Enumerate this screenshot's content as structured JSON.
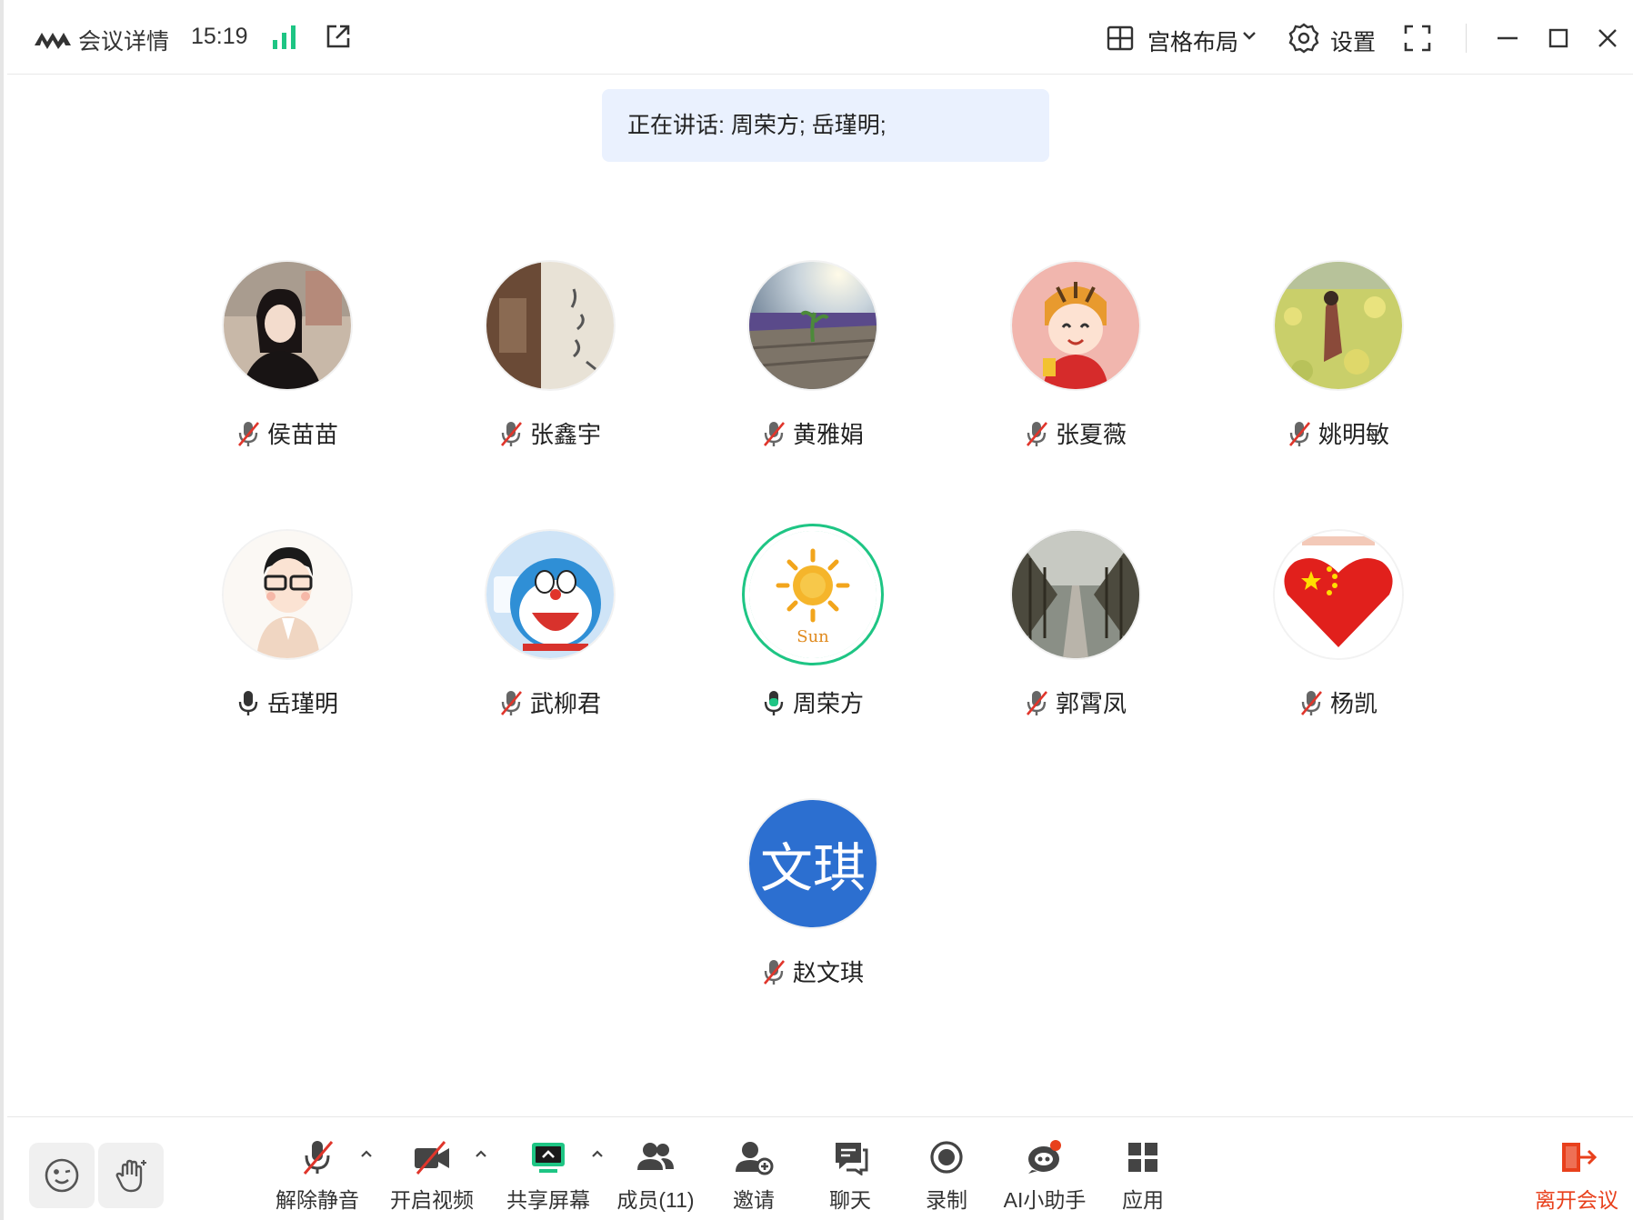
{
  "titlebar": {
    "title": "会议详情",
    "time": "15:19",
    "layout_label": "宫格布局",
    "settings_label": "设置",
    "icons": [
      "app-logo-icon",
      "signal-icon",
      "popout-icon",
      "grid-layout-icon",
      "chevron-down-icon",
      "gear-icon",
      "fullscreen-icon",
      "minimize-icon",
      "maximize-icon",
      "close-icon"
    ]
  },
  "speaking_banner": {
    "text": "正在讲话: 周荣方; 岳瑾明;"
  },
  "participants": [
    {
      "name": "侯苗苗",
      "mic": "muted",
      "avatar": "photo"
    },
    {
      "name": "张鑫宇",
      "mic": "muted",
      "avatar": "photo"
    },
    {
      "name": "黄雅娟",
      "mic": "muted",
      "avatar": "photo"
    },
    {
      "name": "张夏薇",
      "mic": "muted",
      "avatar": "photo"
    },
    {
      "name": "姚明敏",
      "mic": "muted",
      "avatar": "photo"
    },
    {
      "name": "岳瑾明",
      "mic": "on",
      "avatar": "cartoon"
    },
    {
      "name": "武柳君",
      "mic": "muted",
      "avatar": "cartoon"
    },
    {
      "name": "周荣方",
      "mic": "speaking",
      "avatar": "sun-drawing",
      "avatar_text": "Sun"
    },
    {
      "name": "郭霄凤",
      "mic": "muted",
      "avatar": "photo"
    },
    {
      "name": "杨凯",
      "mic": "muted",
      "avatar": "heart-flag"
    },
    {
      "name": "赵文琪",
      "mic": "muted",
      "avatar": "initials",
      "initials": "文琪"
    }
  ],
  "toolbar": {
    "unmute": "解除静音",
    "start_video": "开启视频",
    "share_screen": "共享屏幕",
    "members": "成员(11)",
    "invite": "邀请",
    "chat": "聊天",
    "record": "录制",
    "ai_assistant": "AI小助手",
    "apps": "应用",
    "leave": "离开会议"
  },
  "colors": {
    "accent_blue": "#2c6fd0",
    "speaking_green": "#1ec584",
    "leave_red": "#e8401c",
    "banner_bg": "#eaf1fe",
    "muted_red": "#e0352b"
  }
}
